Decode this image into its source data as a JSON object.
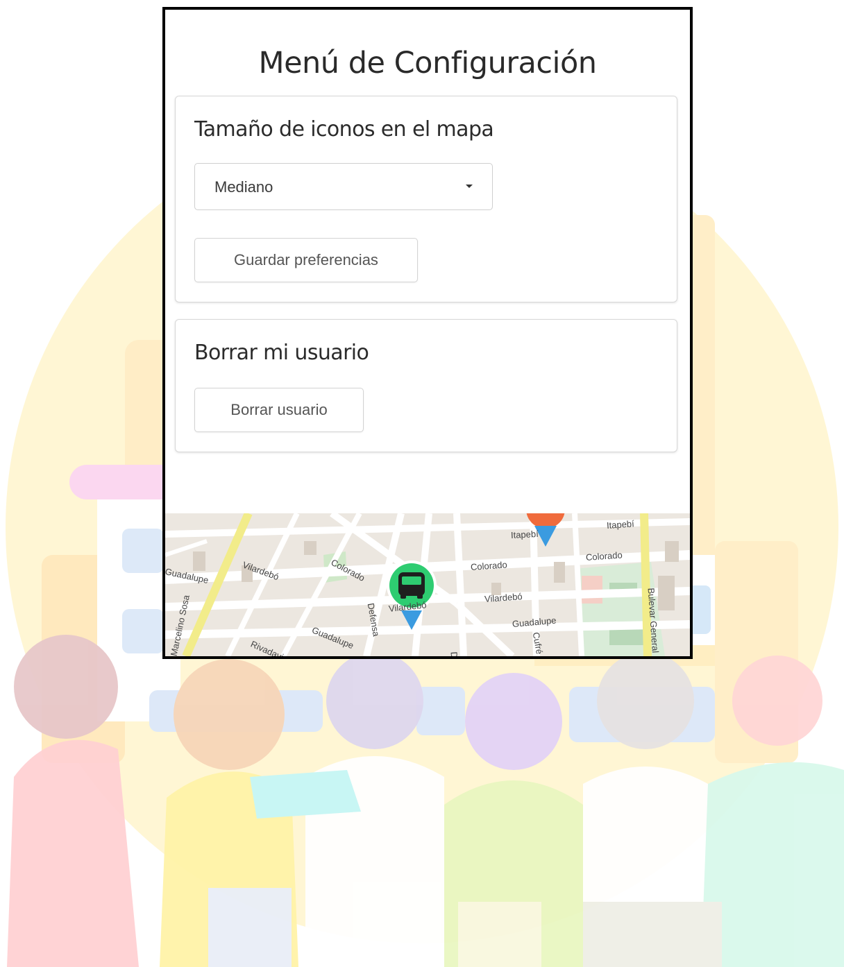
{
  "panel": {
    "title": "Menú de Configuración"
  },
  "icon_size_section": {
    "heading": "Tamaño de iconos en el mapa",
    "select_value": "Mediano",
    "save_button": "Guardar preferencias"
  },
  "delete_section": {
    "heading": "Borrar mi usuario",
    "delete_button": "Borrar usuario"
  },
  "map": {
    "streets": {
      "colorado_1": "Colorado",
      "colorado_2": "Colorado",
      "colorado_3": "Colorado",
      "vilardebo_1": "Vilardebó",
      "vilardebo_2": "Vilardebó",
      "vilardebo_3": "Vilardebó",
      "guadalupe_1": "Guadalupe",
      "guadalupe_2": "Guadalupe",
      "guadalupe_3": "Guadalupe",
      "itapebi_1": "Itapebí",
      "itapebi_2": "Itapebí",
      "rivadavia": "Rivadavia",
      "marcelino_sosa": "Marcelino Sosa",
      "defensa": "Defensa",
      "cufre": "Cufré",
      "bulevar_general": "Bulevar General",
      "do": "Do"
    },
    "pin_bus": "bus-stop-marker",
    "pin_other": "location-marker",
    "colors": {
      "bus_marker": "#2ecc71",
      "pin_tail": "#3b9be0",
      "orange_pin": "#f06b3c"
    }
  },
  "background": {
    "illustration": "group-of-people-hugging-in-front-of-city"
  }
}
